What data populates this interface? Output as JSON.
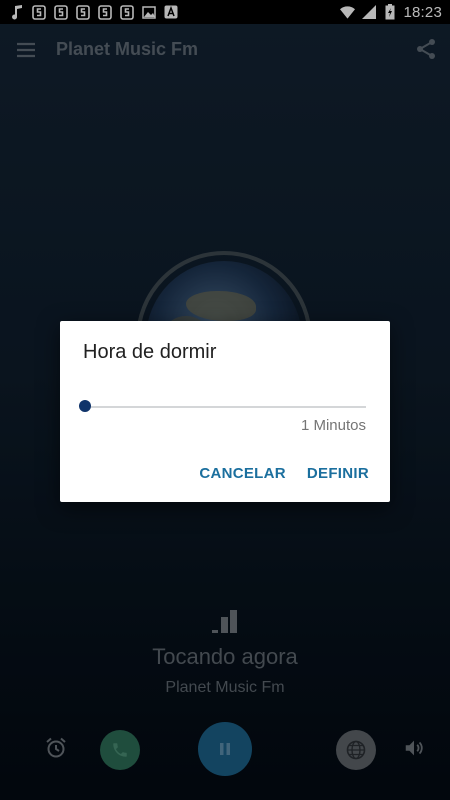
{
  "status_bar": {
    "time": "18:23",
    "left_icons": [
      "music-note-icon",
      "app-s-icon",
      "app-s-icon",
      "app-s-icon",
      "app-s-icon",
      "app-s-icon",
      "image-icon",
      "font-icon"
    ],
    "right_icons": [
      "wifi-icon",
      "signal-icon",
      "battery-icon"
    ]
  },
  "toolbar": {
    "title": "Planet Music Fm",
    "menu_icon": "hamburger-menu-icon",
    "share_icon": "share-icon"
  },
  "player": {
    "now_playing_label": "Tocando agora",
    "station_name": "Planet Music Fm"
  },
  "controls": {
    "alarm_icon": "alarm-clock-icon",
    "phone_icon": "phone-icon",
    "pause_icon": "pause-icon",
    "website_icon": "globe-icon",
    "volume_icon": "volume-icon"
  },
  "dialog": {
    "title": "Hora de dormir",
    "slider_value": "1 Minutos",
    "cancel_label": "CANCELAR",
    "confirm_label": "DEFINIR"
  },
  "colors": {
    "accent": "#1b6f9e",
    "slider_thumb": "#10346a",
    "phone_button": "#2c6b55",
    "play_button": "#1b5f86"
  }
}
